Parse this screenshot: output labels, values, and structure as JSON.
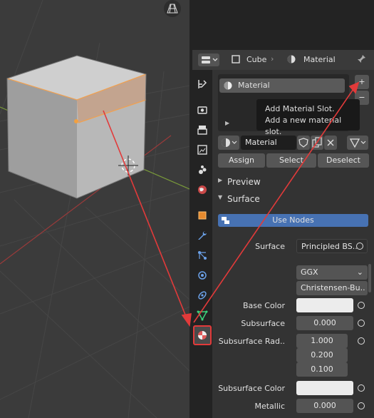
{
  "header": {
    "object_name": "Cube",
    "material_name": "Material"
  },
  "slots": {
    "items": [
      {
        "label": "Material"
      }
    ],
    "add_icon": "+",
    "remove_icon": "−"
  },
  "tooltip": {
    "title": "Add Material Slot.",
    "description": "Add a new material slot."
  },
  "material_selector": {
    "value": "Material"
  },
  "slot_actions": {
    "assign": "Assign",
    "select": "Select",
    "deselect": "Deselect"
  },
  "panels": {
    "preview": "Preview",
    "surface": "Surface"
  },
  "use_nodes": "Use Nodes",
  "surface": {
    "shader_label": "Surface",
    "shader_value": "Principled BS..",
    "distribution": "GGX",
    "subsurface_method": "Christensen-Bu..",
    "base_color_label": "Base Color",
    "subsurface_label": "Subsurface",
    "subsurface_value": "0.000",
    "subsurface_radius_label": "Subsurface Rad..",
    "subsurface_radius": [
      "1.000",
      "0.200",
      "0.100"
    ],
    "subsurface_color_label": "Subsurface Color",
    "metallic_label": "Metallic",
    "metallic_value": "0.000"
  },
  "colors": {
    "accent": "#4772b3",
    "annotation": "#e23a3a",
    "selected_tab": "#e23a3a"
  }
}
